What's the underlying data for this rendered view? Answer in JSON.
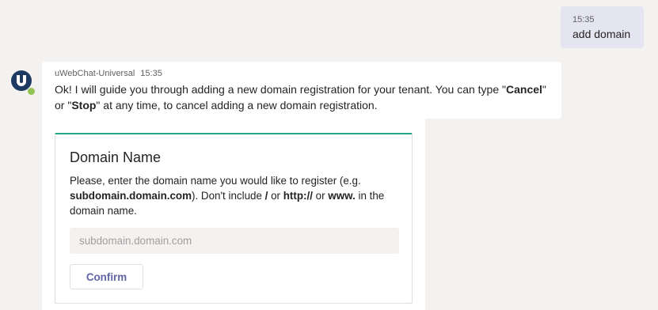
{
  "user_message": {
    "time": "15:35",
    "text": "add domain"
  },
  "bot_message": {
    "sender": "uWebChat-Universal",
    "time": "15:35",
    "text_intro": "Ok! I will guide you through adding a new domain registration for your tenant. You can type \"",
    "cancel_word": "Cancel",
    "text_or": "\" or \"",
    "stop_word": "Stop",
    "text_outro": "\" at any time, to cancel adding a new domain registration."
  },
  "card": {
    "title": "Domain Name",
    "desc_1": "Please, enter the domain name you would like to register (e.g. ",
    "desc_example": "subdomain.domain.com",
    "desc_2": "). Don't include ",
    "desc_slash": "/",
    "desc_or1": " or ",
    "desc_http": "http://",
    "desc_or2": " or ",
    "desc_www": "www.",
    "desc_3": " in the domain name.",
    "input_placeholder": "subdomain.domain.com",
    "input_value": "",
    "confirm_label": "Confirm"
  },
  "colors": {
    "accent": "#6264a7",
    "card_top_border": "#22a586",
    "status_available": "#92c353",
    "user_bubble": "#e5e5f1",
    "background": "#f3f2f1"
  },
  "icons": {
    "avatar": "uwebchat-logo-icon",
    "status": "available-status-icon"
  }
}
